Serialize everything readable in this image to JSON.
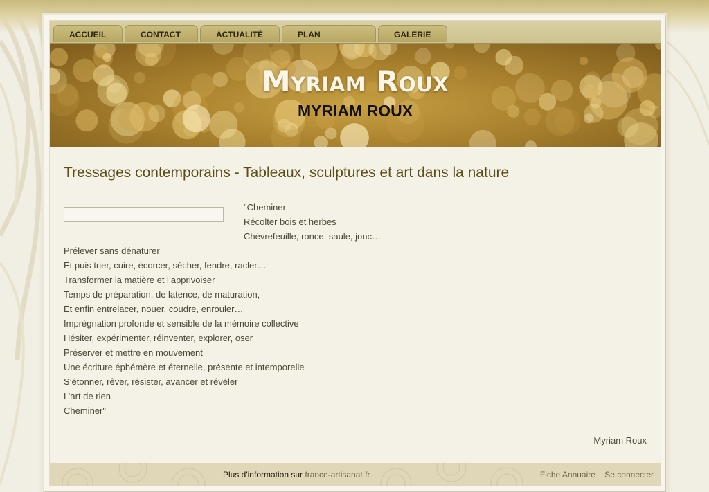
{
  "nav": {
    "items": [
      {
        "label": "Accueil"
      },
      {
        "label": "Contact"
      },
      {
        "label": "Actualité"
      },
      {
        "label": "Plan"
      },
      {
        "label": "Galerie"
      }
    ]
  },
  "header": {
    "title": "Myriam Roux",
    "subtitle": "MYRIAM ROUX"
  },
  "main": {
    "title": "Tressages contemporains - Tableaux, sculptures et art dans la nature",
    "input_value": "",
    "poem_top": [
      "\"Cheminer",
      "Récolter bois et herbes",
      "Chèvrefeuille, ronce, saule, jonc…"
    ],
    "poem": [
      "Prélever sans dénaturer",
      "Et puis trier, cuire, écorcer, sécher, fendre, racler…",
      "Transformer la matière et l’apprivoiser",
      "Temps de préparation, de latence, de maturation,",
      "Et enfin entrelacer, nouer, coudre, enrouler…",
      "Imprégnation profonde et sensible de la mémoire collective",
      "Hésiter, expérimenter, réinventer, explorer, oser",
      "Préserver et mettre en mouvement",
      "Une écriture éphémère et éternelle, présente et intemporelle",
      "S’étonner, rêver, résister, avancer et révéler",
      "L’art de rien",
      "Cheminer\""
    ],
    "signature": "Myriam Roux"
  },
  "footer": {
    "info_text": "Plus d'information sur",
    "info_link": "france-artisanat.fr",
    "links": [
      "Fiche Annuaire",
      "Se connecter"
    ]
  },
  "colors": {
    "page_bg": "#f1eee3",
    "nav_tab": "#c0b16f",
    "title_text": "#5b4d18",
    "banner_gold": "#b08a35"
  }
}
